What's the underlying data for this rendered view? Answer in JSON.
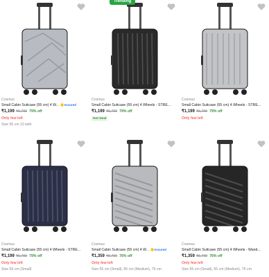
{
  "products": [
    {
      "brand": "Cosmus",
      "title": "Small Cabin Suitcase (55 cm) 4 W...",
      "assured": true,
      "price": "₹1,199",
      "mrp": "₹5,799",
      "off": "79% off",
      "stock": "Only few left",
      "size": "Size 55 cm 10 with",
      "trend": "",
      "deal": "",
      "color": "#b8bcc2"
    },
    {
      "brand": "Cosmus",
      "title": "Small Cabin Suitcase (55 cm) 4 Wheels - STRE...",
      "assured": false,
      "price": "₹1,199",
      "mrp": "₹5,799",
      "off": "79% off",
      "stock": "",
      "size": "",
      "trend": "Trending",
      "deal": "Hot Deal",
      "color": "#2a2a2a"
    },
    {
      "brand": "Cosmus",
      "title": "Small Cabin Suitcase (55 cm) 4 Wheels - STRE...",
      "assured": false,
      "price": "₹1,199",
      "mrp": "₹5,799",
      "off": "79% off",
      "stock": "Only few left",
      "size": "",
      "trend": "",
      "deal": "",
      "color": "#c3c4c7"
    },
    {
      "brand": "Cosmus",
      "title": "Small Cabin Suitcase (55 cm) 4 Wheels - STRE...",
      "assured": false,
      "price": "₹1,199",
      "mrp": "₹5,799",
      "off": "79% off",
      "stock": "Only few left",
      "size": "Size 55 cm (Small)",
      "trend": "",
      "deal": "",
      "color": "#2b3048"
    },
    {
      "brand": "Cosmus",
      "title": "Small Cabin Suitcase (55 cm) 4 W...",
      "assured": true,
      "price": "₹1,359",
      "mrp": "₹5,799",
      "off": "76% off",
      "stock": "Only few left",
      "size": "Size 55 cm (Small), 65 cm (Medium), 75 cm",
      "trend": "",
      "deal": "",
      "color": "#b9babd"
    },
    {
      "brand": "Cosmus",
      "title": "Small Cabin Suitcase (55 cm) 4 Wheels - Wand...",
      "assured": false,
      "price": "₹1,359",
      "mrp": "₹5,799",
      "off": "76% off",
      "stock": "Only few left",
      "size": "Size 55 cm (Small), 65 cm (Medium), 75 cm",
      "trend": "",
      "deal": "",
      "color": "#262626"
    }
  ],
  "assured_label": "Assured",
  "brand_color": "#2874f0"
}
